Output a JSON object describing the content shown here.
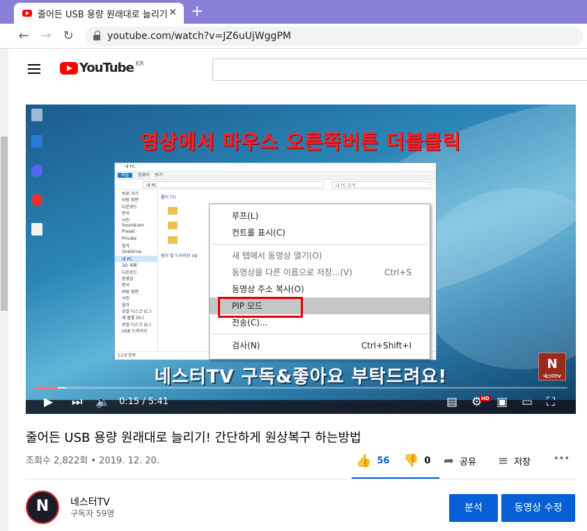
{
  "browser": {
    "tab_title": "줄어든 USB 용량 원래대로 늘리기",
    "tab_close": "✕",
    "new_tab": "+",
    "url": "youtube.com/watch?v=JZ6uUjWggPM"
  },
  "youtube_header": {
    "logo_text": "YouTube",
    "country": "KR"
  },
  "video_frame": {
    "headline": "영상에서 마우스 오른쪽버튼 더블클릭",
    "subtitle": "네스터TV 구독&좋아요 부탁드려요!",
    "corner_logo": "N",
    "corner_logo_caption": "네스터TV",
    "explorer": {
      "title": "내 PC",
      "ribbon_tabs": [
        "파일",
        "컴퓨터",
        "보기"
      ],
      "address": "내 PC",
      "search_placeholder": "내 PC 검색",
      "group_folders": "폴더 (7)",
      "group_devices": "장치 및 드라이브 (4)",
      "status": "12개 항목",
      "nav_items": [
        "바로 가기",
        "바탕 화면",
        "다운로드",
        "문서",
        "사진",
        "Soundcam",
        "Preset",
        "Private",
        "음악",
        "OneDrive",
        "내 PC",
        "3D 개체",
        "다운로드",
        "동영상",
        "문서",
        "바탕 화면",
        "사진",
        "음악",
        "로컬 디스크 (C:)",
        "새 볼륨 (D:)",
        "로컬 디스크 (E:)",
        "USB 드라이브"
      ]
    },
    "context_menu": {
      "items": [
        {
          "label": "루프(L)",
          "shortcut": "",
          "disabled": false
        },
        {
          "label": "컨트롤 표시(C)",
          "shortcut": "",
          "disabled": false
        },
        {
          "label": "새 탭에서 동영상 열기(O)",
          "shortcut": "",
          "disabled": true
        },
        {
          "label": "동영상을 다른 이름으로 저장...(V)",
          "shortcut": "Ctrl+S",
          "disabled": true
        },
        {
          "label": "동영상 주소 복사(O)",
          "shortcut": "",
          "disabled": false
        },
        {
          "label": "PIP 모드",
          "shortcut": "",
          "disabled": false
        },
        {
          "label": "전송(C)...",
          "shortcut": "",
          "disabled": false
        },
        {
          "label": "검사(N)",
          "shortcut": "Ctrl+Shift+I",
          "disabled": false
        }
      ]
    }
  },
  "player": {
    "current_time": "0:15",
    "duration": "5:41",
    "time_display": "0:15 / 5:41",
    "progress_fraction": 0.044,
    "buffer_fraction": 0.06,
    "hd_badge": "HD"
  },
  "video_info": {
    "title": "줄어든 USB 용량 원래대로 늘리기! 간단하게 원상복구 하는방법",
    "views_date": "조회수 2,822회 • 2019. 12. 20.",
    "likes": "56",
    "dislikes": "0",
    "share_label": "공유",
    "save_label": "저장",
    "more": "•••"
  },
  "channel": {
    "name": "네스터TV",
    "subscribers": "구독자 59명",
    "avatar_letter": "N",
    "analytics_button": "분석",
    "edit_button": "동영상 수정"
  },
  "colors": {
    "accent": "#065fd4",
    "youtube_red": "#ff0000",
    "tabbar": "#8a7fd6",
    "highlight_outline": "#e00000"
  }
}
